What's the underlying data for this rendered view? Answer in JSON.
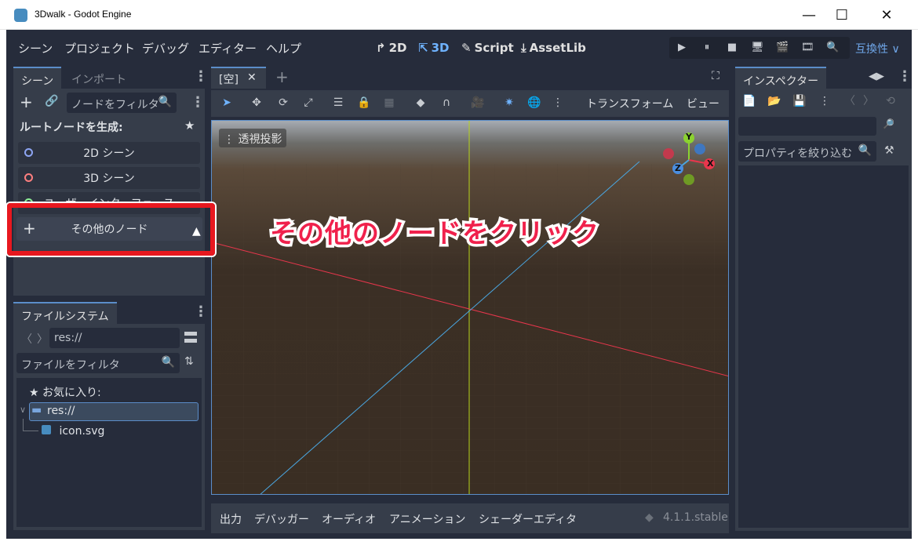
{
  "window": {
    "title": "3Dwalk - Godot Engine",
    "minimize": "—",
    "maximize": "☐",
    "close": "✕"
  },
  "menu": [
    "シーン",
    "プロジェクト",
    "デバッグ",
    "エディター",
    "ヘルプ"
  ],
  "main_tabs": [
    {
      "icon": "↱",
      "label": "2D"
    },
    {
      "icon": "⇱",
      "label": "3D"
    },
    {
      "icon": "✎",
      "label": "Script"
    },
    {
      "icon": "⤓",
      "label": "AssetLib"
    }
  ],
  "run_buttons": [
    "▶",
    "⏸",
    "■",
    "🖥",
    "🎬",
    "🎞",
    "🔍"
  ],
  "compat_label": "互換性 ∨",
  "scene_dock": {
    "tabs": [
      "シーン",
      "インポート"
    ],
    "filter_placeholder": "ノードをフィルタ",
    "create_root_label": "ルートノードを生成:",
    "buttons": [
      {
        "label": "2D シーン",
        "color": "#8da5f3"
      },
      {
        "label": "3D シーン",
        "color": "#fc7f7f"
      },
      {
        "label": "ユーザーインターフェース",
        "color": "#8eef97"
      }
    ],
    "other_node": "その他のノード"
  },
  "filesystem": {
    "tab": "ファイルシステム",
    "path": "res://",
    "filter_placeholder": "ファイルをフィルタ",
    "favorites": "お気に入り:",
    "root": "res://",
    "file": "icon.svg"
  },
  "viewport": {
    "tab_label": "[空]",
    "close": "✕",
    "add": "+",
    "perspective": "透視投影",
    "transform_menu": "トランスフォーム",
    "view_menu": "ビュー",
    "gizmo": {
      "y": "Y",
      "x": "X",
      "z": "Z"
    }
  },
  "bottom_panel": [
    "出力",
    "デバッガー",
    "オーディオ",
    "アニメーション",
    "シェーダーエディタ"
  ],
  "version": "4.1.1.stable",
  "inspector": {
    "tab": "インスペクター",
    "filter_placeholder": "プロパティを絞り込む"
  },
  "annotation": "その他のノードをクリック",
  "colors": {
    "accent": "#5b8dc9",
    "highlight": "#e8181f",
    "annotation": "#f0214c"
  }
}
